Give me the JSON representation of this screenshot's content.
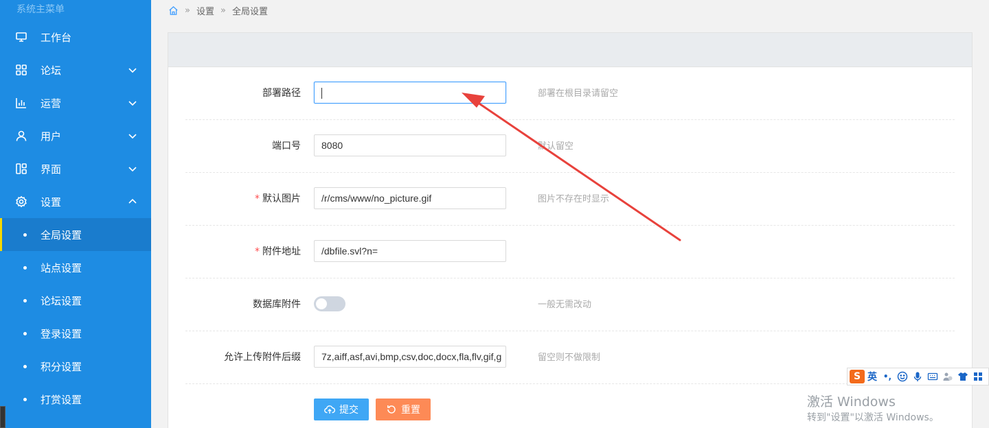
{
  "sidebar": {
    "title": "系统主菜单",
    "menu": [
      {
        "label": "工作台"
      },
      {
        "label": "论坛"
      },
      {
        "label": "运营"
      },
      {
        "label": "用户"
      },
      {
        "label": "界面"
      },
      {
        "label": "设置"
      }
    ],
    "sub": [
      {
        "label": "全局设置",
        "active": true
      },
      {
        "label": "站点设置"
      },
      {
        "label": "论坛设置"
      },
      {
        "label": "登录设置"
      },
      {
        "label": "积分设置"
      },
      {
        "label": "打赏设置"
      }
    ]
  },
  "breadcrumb": {
    "items": [
      "设置",
      "全局设置"
    ]
  },
  "form": {
    "deploy_path": {
      "label": "部署路径",
      "value": "",
      "hint": "部署在根目录请留空"
    },
    "port": {
      "label": "端口号",
      "value": "8080",
      "hint": "默认留空"
    },
    "default_picture": {
      "label": "默认图片",
      "value": "/r/cms/www/no_picture.gif",
      "hint": "图片不存在时显示"
    },
    "attachment_url": {
      "label": "附件地址",
      "value": "/dbfile.svl?n=",
      "hint": ""
    },
    "db_attachment": {
      "label": "数据库附件",
      "enabled": false,
      "hint": "一般无需改动"
    },
    "upload_suffix": {
      "label": "允许上传附件后缀",
      "value": "7z,aiff,asf,avi,bmp,csv,doc,docx,fla,flv,gif,g",
      "hint": "留空则不做限制"
    },
    "submit_label": "提交",
    "reset_label": "重置"
  },
  "ime": {
    "logo": "S",
    "mode": "英",
    "punct": "•,"
  },
  "watermark": {
    "line1": "激活 Windows",
    "line2": "转到\"设置\"以激活 Windows。"
  },
  "colors": {
    "sidebar": "#1e8ce3",
    "sidebar_active": "#1a7ccd",
    "active_marker": "#f5d800",
    "submit": "#3fa7f5",
    "reset": "#fd8a56",
    "arrow": "#e8423c",
    "required": "#ff4d4f"
  }
}
